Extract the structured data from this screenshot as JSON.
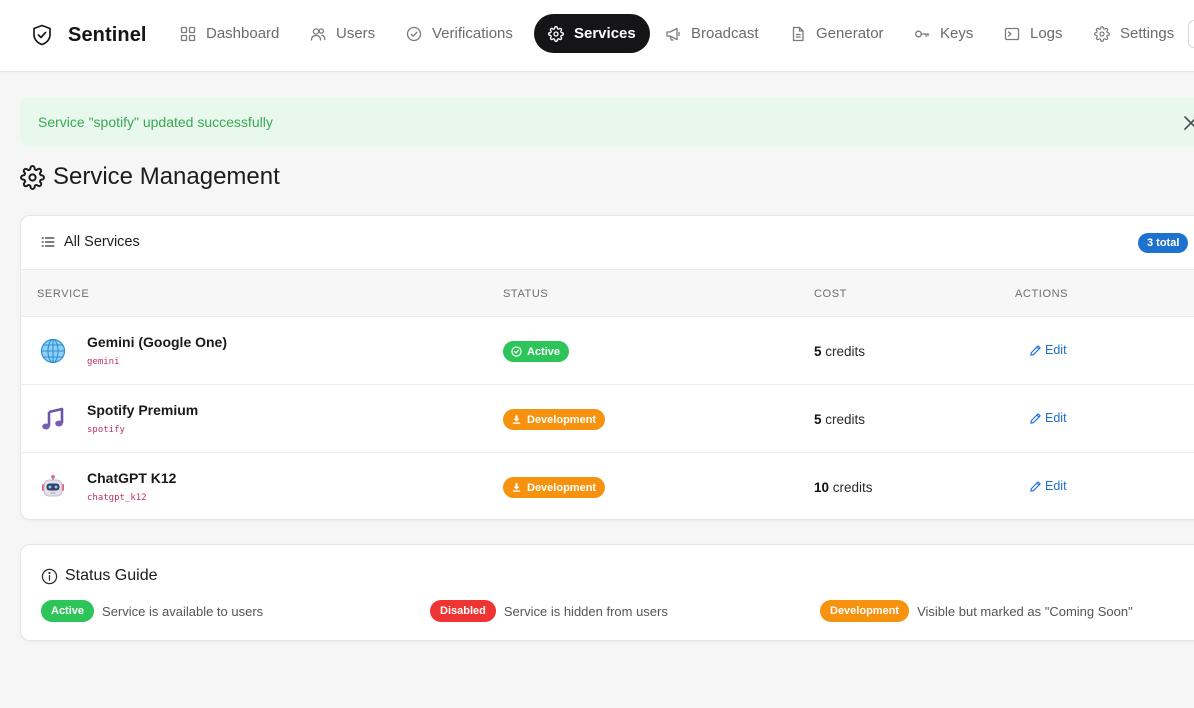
{
  "nav": {
    "brand": "Sentinel",
    "items": [
      {
        "label": "Dashboard",
        "icon": "grid-icon",
        "active": false
      },
      {
        "label": "Users",
        "icon": "users-icon",
        "active": false
      },
      {
        "label": "Verifications",
        "icon": "check-circle-icon",
        "active": false
      },
      {
        "label": "Services",
        "icon": "gear-icon",
        "active": true
      },
      {
        "label": "Broadcast",
        "icon": "megaphone-icon",
        "active": false
      },
      {
        "label": "Generator",
        "icon": "document-icon",
        "active": false
      },
      {
        "label": "Keys",
        "icon": "key-icon",
        "active": false
      },
      {
        "label": "Logs",
        "icon": "terminal-icon",
        "active": false
      },
      {
        "label": "Settings",
        "icon": "settings-icon",
        "active": false
      }
    ]
  },
  "alert": {
    "message": "Service \"spotify\" updated successfully",
    "close_icon": "close-icon"
  },
  "page": {
    "title": "Service Management",
    "title_icon": "gear-icon"
  },
  "services_card": {
    "title": "All Services",
    "title_icon": "list-icon",
    "total_badge": "3 total",
    "columns": [
      "SERVICE",
      "STATUS",
      "COST",
      "ACTIONS"
    ],
    "rows": [
      {
        "name": "Gemini (Google One)",
        "code": "gemini",
        "icon": "globe-icon",
        "status": "Active",
        "status_icon": "check-circle-icon",
        "cost_value": "5",
        "cost_unit": "credits",
        "action": "Edit"
      },
      {
        "name": "Spotify Premium",
        "code": "spotify",
        "icon": "music-note-icon",
        "status": "Development",
        "status_icon": "download-icon",
        "cost_value": "5",
        "cost_unit": "credits",
        "action": "Edit"
      },
      {
        "name": "ChatGPT K12",
        "code": "chatgpt_k12",
        "icon": "robot-icon",
        "status": "Development",
        "status_icon": "download-icon",
        "cost_value": "10",
        "cost_unit": "credits",
        "action": "Edit"
      }
    ]
  },
  "status_guide": {
    "title": "Status Guide",
    "title_icon": "info-icon",
    "items": [
      {
        "label": "Active",
        "description": "Service is available to users",
        "color": "#2dc55a"
      },
      {
        "label": "Disabled",
        "description": "Service is hidden from users",
        "color": "#ef3434"
      },
      {
        "label": "Development",
        "description": "Visible but marked as \"Coming Soon\"",
        "color": "#f7920f"
      }
    ]
  },
  "colors": {
    "accent_blue": "#1d72d0",
    "success_green": "#2dc55a",
    "warning_orange": "#f7920f",
    "danger_red": "#ef3434",
    "nav_active": "#151517"
  }
}
